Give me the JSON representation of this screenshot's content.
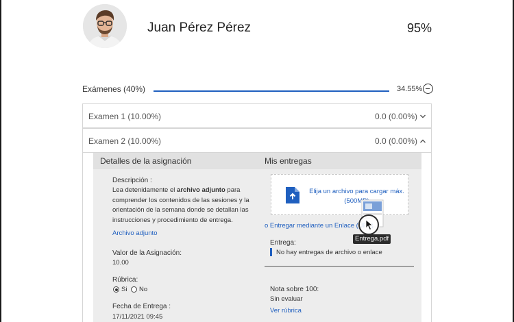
{
  "student": {
    "name": "Juan Pérez Pérez",
    "grade_total": "95%"
  },
  "category": {
    "label": "Exámenes (40%)",
    "value": "34.55%",
    "progress": 0.3455
  },
  "exams": [
    {
      "label": "Examen 1 (10.00%)",
      "value": "0.0 (0.00%)",
      "expanded": false
    },
    {
      "label": "Examen 2 (10.00%)",
      "value": "0.0 (0.00%)",
      "expanded": true
    }
  ],
  "details": {
    "header_left": "Detalles de la asignación",
    "header_right": "Mis entregas",
    "description_label": "Descripción :",
    "description_1": "Lea detenidamente el ",
    "description_bold": "archivo adjunto",
    "description_2": " para comprender los contenidos de las sesiones y la orientación de la semana donde se detallan las instrucciones y procedimiento de entrega.",
    "attachment_link": "Archivo adjunto",
    "value_label": "Valor de la Asignación:",
    "value": "10.00",
    "rubric_label": "Rúbrica:",
    "rubric_yes": "Si",
    "rubric_no": "No",
    "due_label": "Fecha de Entrega :",
    "due_date": "17/11/2021 09:45"
  },
  "submissions": {
    "upload_text": "Elija un archivo para cargar máx. (500MB)",
    "link_option": "o Entregar mediante un Enlace (URL)",
    "dragged_file": "Entrega.pdf",
    "submission_label": "Entrega:",
    "submission_empty": "No hay entregas de archivo o enlace",
    "grade_label": "Nota sobre 100:",
    "grade_value": "Sin evaluar",
    "rubric_link": "Ver rúbrica"
  },
  "colors": {
    "accent": "#1f5fbf",
    "panel_bg": "#ededed",
    "panel_header": "#e1e1e1"
  }
}
